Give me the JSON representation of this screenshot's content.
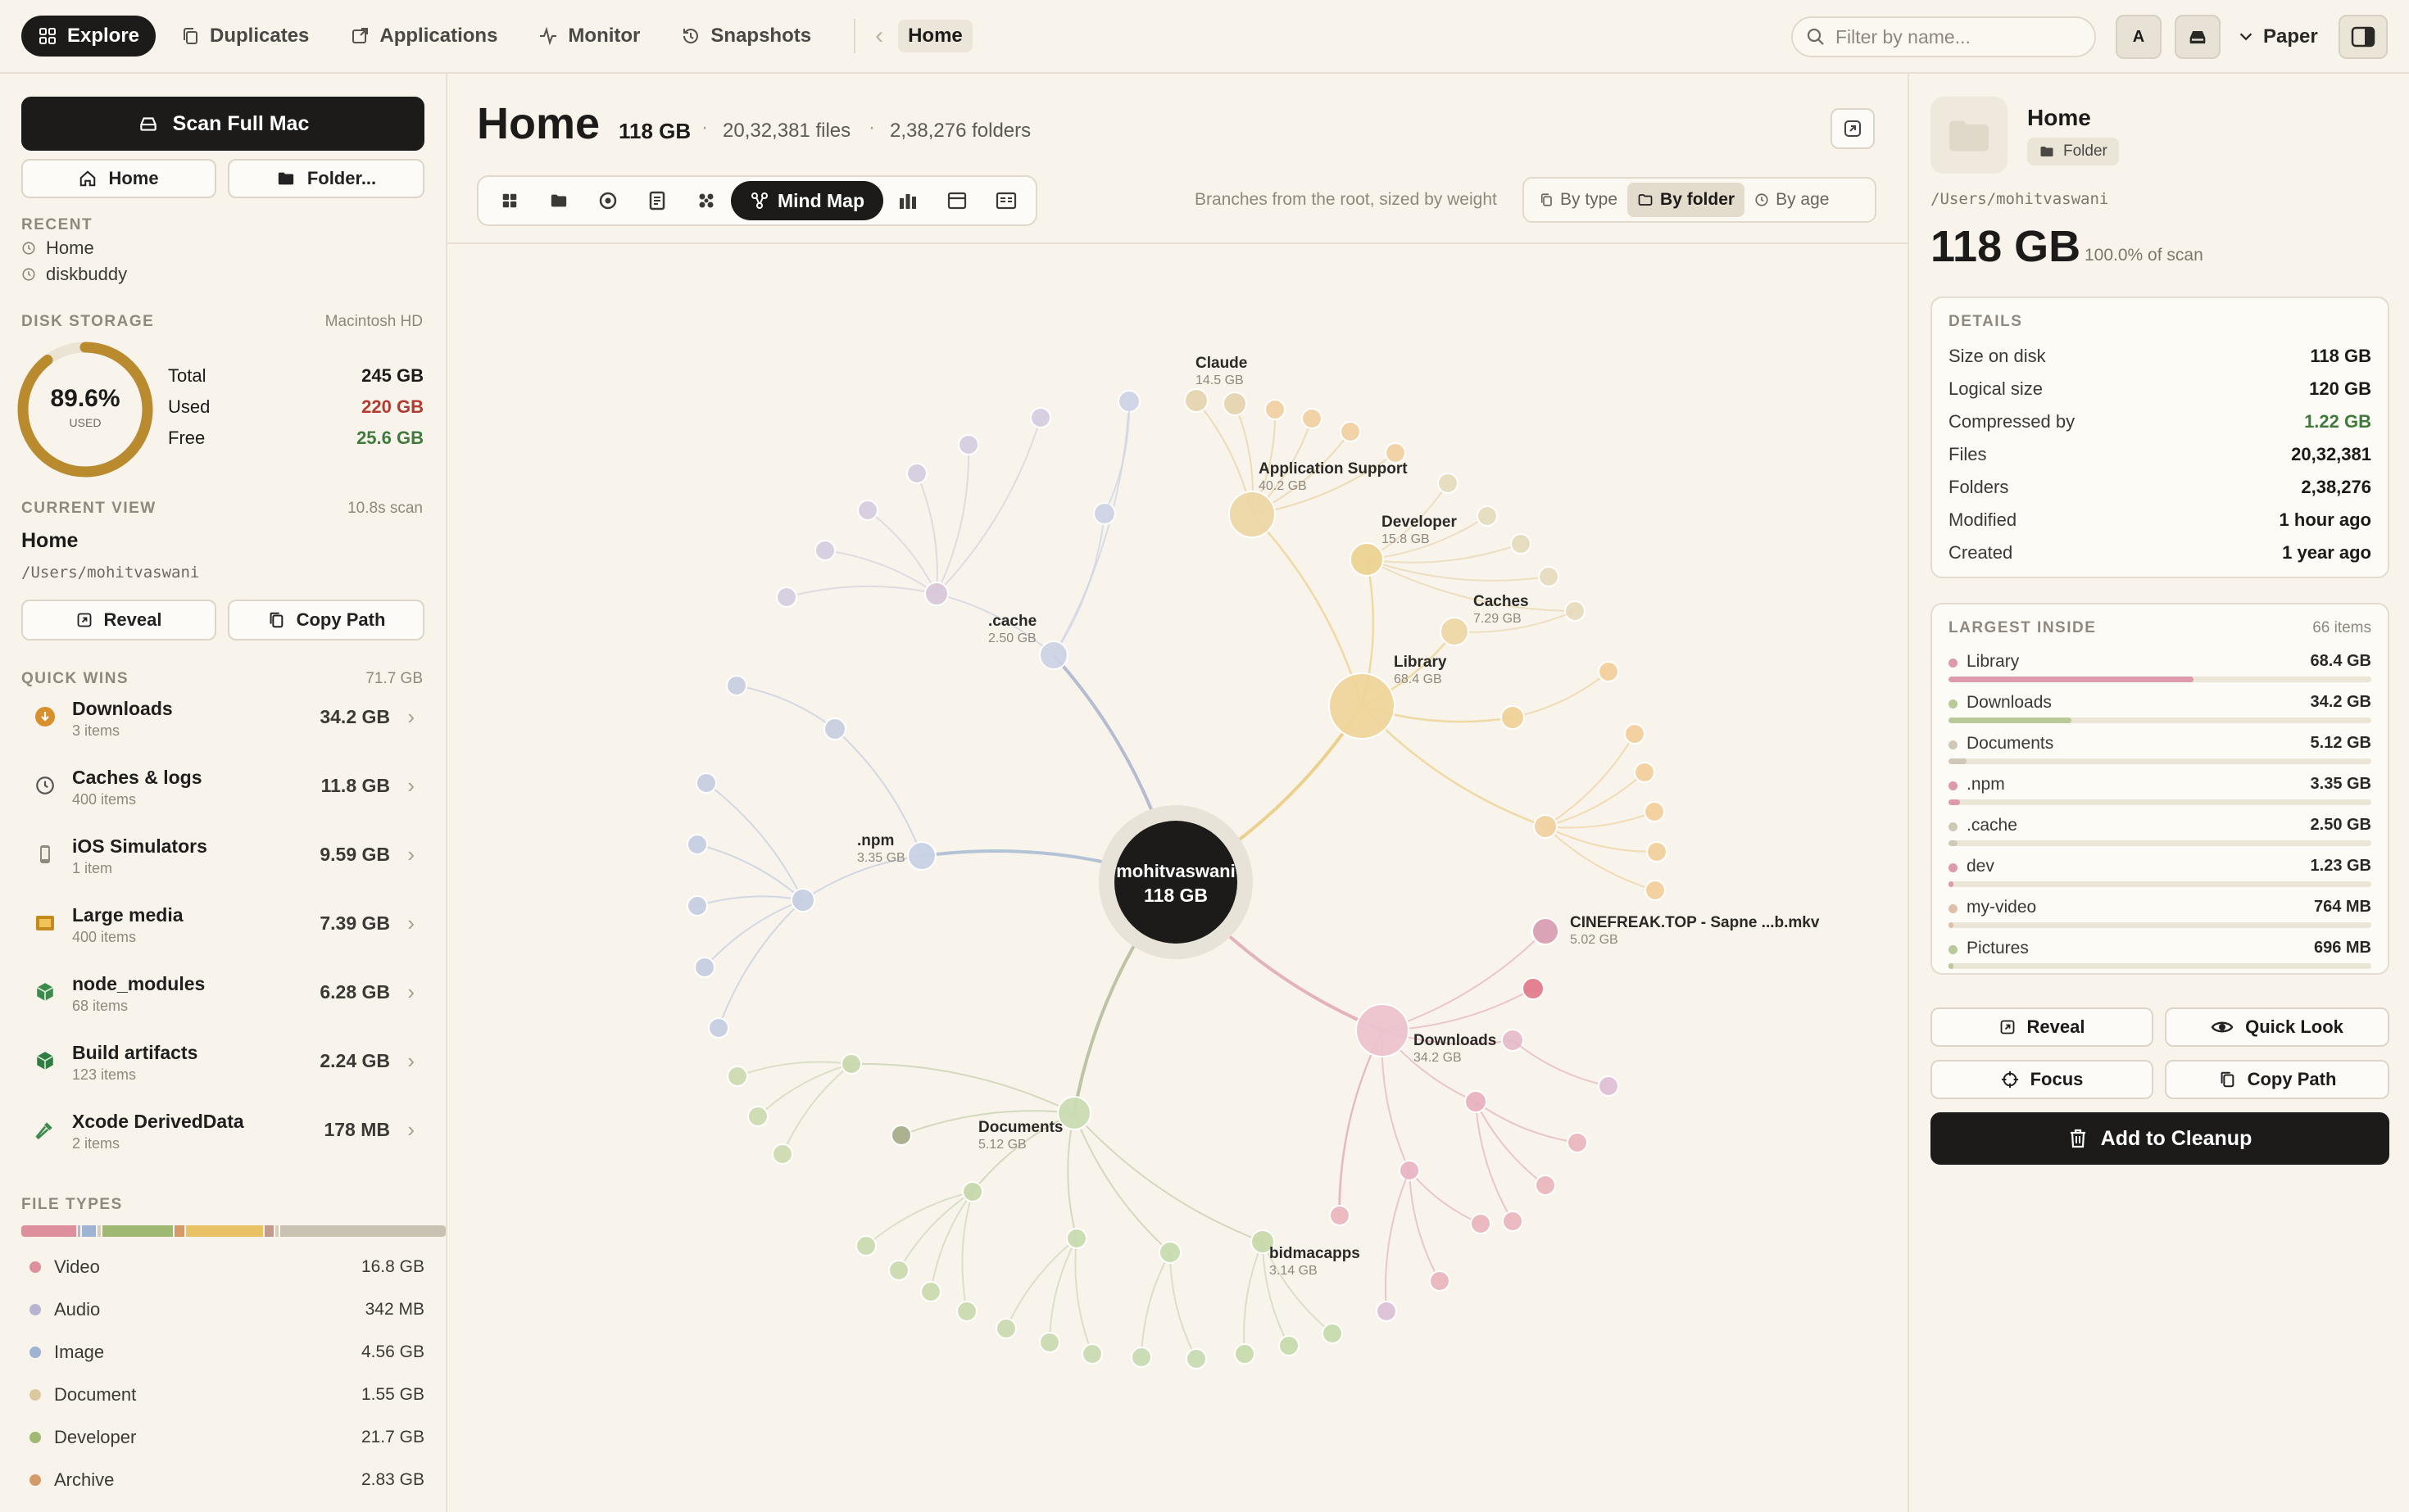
{
  "nav": {
    "tabs": [
      {
        "label": "Explore",
        "icon": "grid-icon"
      },
      {
        "label": "Duplicates",
        "icon": "copy-icon"
      },
      {
        "label": "Applications",
        "icon": "app-icon"
      },
      {
        "label": "Monitor",
        "icon": "activity-icon"
      },
      {
        "label": "Snapshots",
        "icon": "history-icon"
      }
    ],
    "breadcrumb": "Home",
    "search_placeholder": "Filter by name...",
    "avatar_label": "A",
    "theme_label": "Paper"
  },
  "sidebar": {
    "scan_label": "Scan Full Mac",
    "home_label": "Home",
    "folder_label": "Folder...",
    "recent_title": "RECENT",
    "recent": [
      "Home",
      "diskbuddy"
    ],
    "disk_title": "DISK STORAGE",
    "disk_name": "Macintosh HD",
    "used_pct": "89.6%",
    "used_pct_value": 0.896,
    "used_caption": "USED",
    "total_label": "Total",
    "total": "245 GB",
    "used_label": "Used",
    "used": "220 GB",
    "free_label": "Free",
    "free": "25.6 GB",
    "current_title": "CURRENT VIEW",
    "scan_time": "10.8s scan",
    "current_name": "Home",
    "current_path": "/Users/mohitvaswani",
    "reveal_label": "Reveal",
    "copy_path_label": "Copy Path",
    "quickwins_title": "QUICK WINS",
    "quickwins_total": "71.7 GB",
    "quickwins": [
      {
        "name": "Downloads",
        "sub": "3 items",
        "size": "34.2 GB",
        "icon": "download-icon"
      },
      {
        "name": "Caches & logs",
        "sub": "400 items",
        "size": "11.8 GB",
        "icon": "clock-icon"
      },
      {
        "name": "iOS Simulators",
        "sub": "1 item",
        "size": "9.59 GB",
        "icon": "phone-icon"
      },
      {
        "name": "Large media",
        "sub": "400 items",
        "size": "7.39 GB",
        "icon": "film-icon"
      },
      {
        "name": "node_modules",
        "sub": "68 items",
        "size": "6.28 GB",
        "icon": "package-icon"
      },
      {
        "name": "Build artifacts",
        "sub": "123 items",
        "size": "2.24 GB",
        "icon": "box-icon"
      },
      {
        "name": "Xcode DerivedData",
        "sub": "2 items",
        "size": "178 MB",
        "icon": "hammer-icon"
      }
    ],
    "filetypes_title": "FILE TYPES",
    "filetypes": [
      {
        "name": "Video",
        "size": "16.8 GB",
        "color": "#dd8f9e"
      },
      {
        "name": "Audio",
        "size": "342 MB",
        "color": "#b8b3cf"
      },
      {
        "name": "Image",
        "size": "4.56 GB",
        "color": "#9fb3d3"
      },
      {
        "name": "Document",
        "size": "1.55 GB",
        "color": "#dcc8a0"
      },
      {
        "name": "Developer",
        "size": "21.7 GB",
        "color": "#9fb872"
      },
      {
        "name": "Archive",
        "size": "2.83 GB",
        "color": "#d49a6a"
      }
    ]
  },
  "main": {
    "title": "Home",
    "size": "118 GB",
    "files": "20,32,381 files",
    "folders": "2,38,276 folders",
    "active_view": "Mind Map",
    "hint": "Branches from the root, sized by weight",
    "segments": [
      "By type",
      "By folder",
      "By age"
    ]
  },
  "mindmap": {
    "root_name": "mohitvaswani",
    "root_size": "118 GB",
    "labels": [
      {
        "name": "Claude",
        "size": "14.5 GB"
      },
      {
        "name": "Application Support",
        "size": "40.2 GB"
      },
      {
        "name": "Developer",
        "size": "15.8 GB"
      },
      {
        "name": "Caches",
        "size": "7.29 GB"
      },
      {
        "name": "Library",
        "size": "68.4 GB"
      },
      {
        "name": ".cache",
        "size": "2.50 GB"
      },
      {
        "name": ".npm",
        "size": "3.35 GB"
      },
      {
        "name": "CINEFREAK.TOP - Sapne ...b.mkv",
        "size": "5.02 GB"
      },
      {
        "name": "Downloads",
        "size": "34.2 GB"
      },
      {
        "name": "Documents",
        "size": "5.12 GB"
      },
      {
        "name": "bidmacapps",
        "size": "3.14 GB"
      }
    ]
  },
  "inspector": {
    "name": "Home",
    "type": "Folder",
    "path": "/Users/mohitvaswani",
    "size": "118 GB",
    "pct": "100.0% of scan",
    "details_title": "DETAILS",
    "details": [
      {
        "k": "Size on disk",
        "v": "118 GB"
      },
      {
        "k": "Logical size",
        "v": "120 GB"
      },
      {
        "k": "Compressed by",
        "v": "1.22 GB",
        "accent": true
      },
      {
        "k": "Files",
        "v": "20,32,381"
      },
      {
        "k": "Folders",
        "v": "2,38,276"
      },
      {
        "k": "Modified",
        "v": "1 hour ago"
      },
      {
        "k": "Created",
        "v": "1 year ago"
      }
    ],
    "largest_title": "LARGEST INSIDE",
    "largest_count": "66 items",
    "largest": [
      {
        "name": "Library",
        "size": "68.4 GB",
        "frac": 0.58,
        "color": "#dd9aaa"
      },
      {
        "name": "Downloads",
        "size": "34.2 GB",
        "frac": 0.29,
        "color": "#b9c99a"
      },
      {
        "name": "Documents",
        "size": "5.12 GB",
        "frac": 0.043,
        "color": "#cfc7b7"
      },
      {
        "name": ".npm",
        "size": "3.35 GB",
        "frac": 0.028,
        "color": "#dd9aaa"
      },
      {
        "name": ".cache",
        "size": "2.50 GB",
        "frac": 0.021,
        "color": "#cfc7b7"
      },
      {
        "name": "dev",
        "size": "1.23 GB",
        "frac": 0.01,
        "color": "#dd9aaa"
      },
      {
        "name": "my-video",
        "size": "764 MB",
        "frac": 0.006,
        "color": "#dcc0a8"
      },
      {
        "name": "Pictures",
        "size": "696 MB",
        "frac": 0.006,
        "color": "#b9c99a"
      }
    ],
    "reveal_label": "Reveal",
    "quicklook_label": "Quick Look",
    "focus_label": "Focus",
    "copy_path_label": "Copy Path",
    "cleanup_label": "Add to Cleanup"
  }
}
